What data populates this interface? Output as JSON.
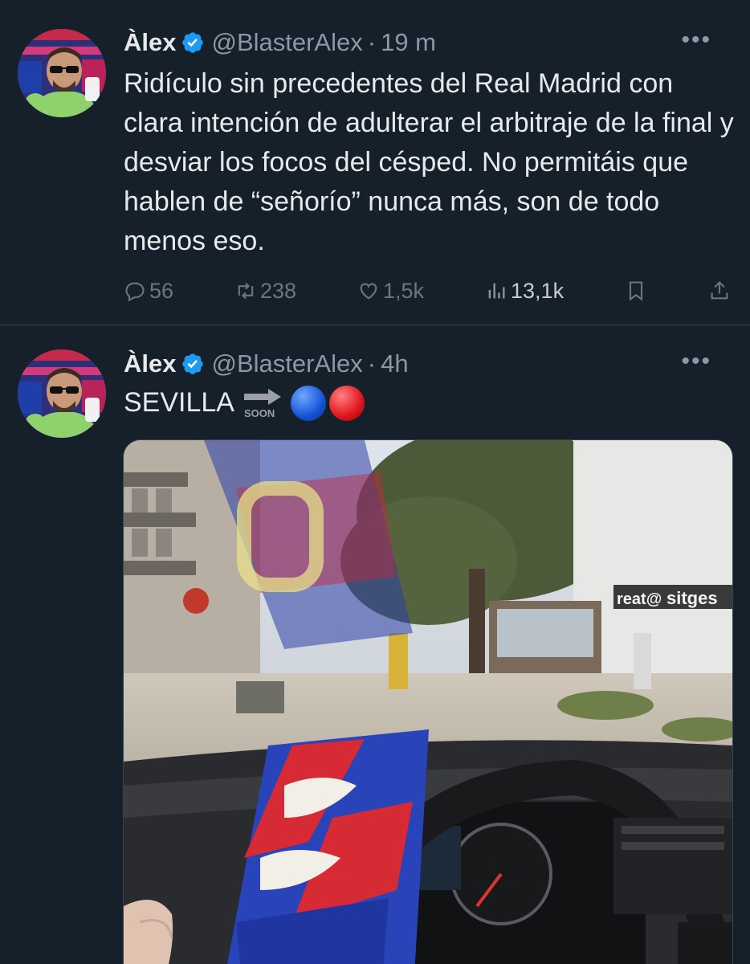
{
  "tweets": [
    {
      "name": "Àlex",
      "handle": "@BlasterAlex",
      "separator": "·",
      "time": "19 m",
      "more": "•••",
      "text": "Ridículo sin precedentes del Real Madrid con clara intención de adulterar el arbitraje de la final y desviar los focos del césped. No permitáis que hablen de “señorío” nunca más, son de todo menos eso.",
      "actions": {
        "replies": "56",
        "retweets": "238",
        "likes": "1,5k",
        "views": "13,1k"
      }
    },
    {
      "name": "Àlex",
      "handle": "@BlasterAlex",
      "separator": "·",
      "time": "4h",
      "more": "•••",
      "text": "SEVILLA",
      "soon_label": "SOON",
      "photo_sign_text": "sitges",
      "photo_sign_prefix": "reat@"
    }
  ],
  "colors": {
    "background": "#15202b",
    "verified": "#1d9bf0",
    "muted": "#8b98a5",
    "text": "#e7e9ea"
  },
  "icons": [
    "verified-badge-icon",
    "more-icon",
    "reply-icon",
    "retweet-icon",
    "like-icon",
    "views-icon",
    "bookmark-icon",
    "share-icon",
    "soon-arrow-icon",
    "blue-circle-icon",
    "red-circle-icon"
  ]
}
